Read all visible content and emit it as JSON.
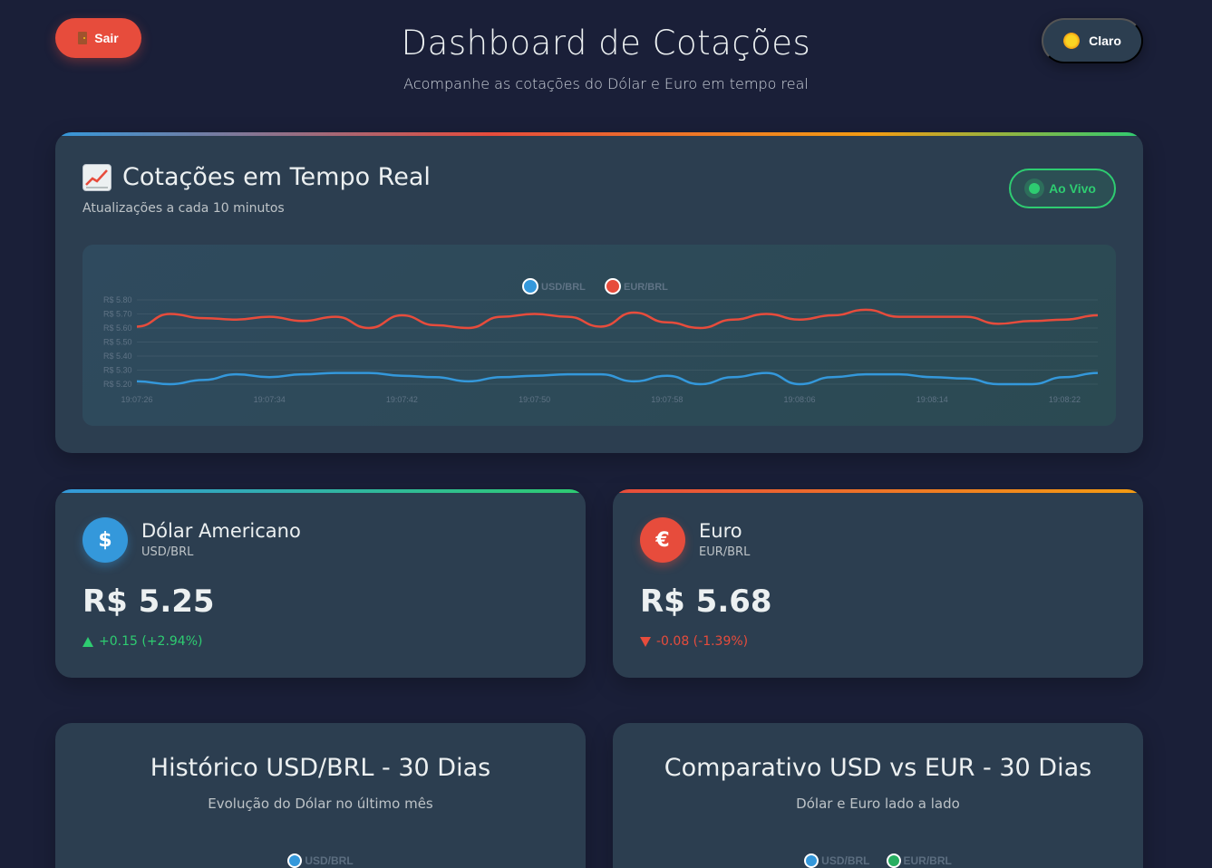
{
  "topbar": {
    "logout_label": "Sair",
    "theme_label": "Claro"
  },
  "header": {
    "title": "Dashboard de Cotações",
    "subtitle": "Acompanhe as cotações do Dólar e Euro em tempo real"
  },
  "realtime": {
    "title": "Cotações em Tempo Real",
    "subtitle": "Atualizações a cada 10 minutos",
    "live_label": "Ao Vivo"
  },
  "chart_data": {
    "type": "line",
    "x": [
      "19:07:26",
      "19:07:28",
      "19:07:30",
      "19:07:32",
      "19:07:34",
      "19:07:36",
      "19:07:38",
      "19:07:40",
      "19:07:42",
      "19:07:44",
      "19:07:46",
      "19:07:48",
      "19:07:50",
      "19:07:52",
      "19:07:54",
      "19:07:56",
      "19:07:58",
      "19:08:00",
      "19:08:02",
      "19:08:04",
      "19:08:06",
      "19:08:08",
      "19:08:10",
      "19:08:12",
      "19:08:14",
      "19:08:16",
      "19:08:18",
      "19:08:20",
      "19:08:22",
      "19:08:24"
    ],
    "x_ticks": [
      "19:07:26",
      "19:07:34",
      "19:07:42",
      "19:07:50",
      "19:07:58",
      "19:08:06",
      "19:08:14",
      "19:08:22"
    ],
    "y_ticks": [
      "R$ 5.80",
      "R$ 5.70",
      "R$ 5.60",
      "R$ 5.50",
      "R$ 5.40",
      "R$ 5.30",
      "R$ 5.20"
    ],
    "ylim": [
      5.2,
      5.8
    ],
    "series": [
      {
        "name": "USD/BRL",
        "color": "#3498db",
        "values": [
          5.22,
          5.2,
          5.23,
          5.27,
          5.25,
          5.27,
          5.28,
          5.28,
          5.26,
          5.25,
          5.22,
          5.25,
          5.26,
          5.27,
          5.27,
          5.22,
          5.26,
          5.2,
          5.25,
          5.28,
          5.2,
          5.25,
          5.27,
          5.27,
          5.25,
          5.24,
          5.2,
          5.2,
          5.25,
          5.28
        ]
      },
      {
        "name": "EUR/BRL",
        "color": "#e74c3c",
        "values": [
          5.61,
          5.7,
          5.67,
          5.66,
          5.68,
          5.65,
          5.68,
          5.6,
          5.69,
          5.62,
          5.6,
          5.68,
          5.7,
          5.68,
          5.61,
          5.71,
          5.64,
          5.6,
          5.66,
          5.7,
          5.66,
          5.69,
          5.73,
          5.68,
          5.68,
          5.68,
          5.63,
          5.65,
          5.66,
          5.69
        ]
      }
    ]
  },
  "currencies": {
    "usd": {
      "symbol": "$",
      "name": "Dólar Americano",
      "pair": "USD/BRL",
      "value": "R$ 5.25",
      "change": "+0.15 (+2.94%)"
    },
    "eur": {
      "symbol": "€",
      "name": "Euro",
      "pair": "EUR/BRL",
      "value": "R$ 5.68",
      "change": "-0.08 (-1.39%)"
    }
  },
  "history": {
    "usd": {
      "title": "Histórico USD/BRL - 30 Dias",
      "subtitle": "Evolução do Dólar no último mês",
      "legend": [
        "USD/BRL"
      ],
      "legend_colors": [
        "#3498db"
      ]
    },
    "compare": {
      "title": "Comparativo USD vs EUR - 30 Dias",
      "subtitle": "Dólar e Euro lado a lado",
      "legend": [
        "USD/BRL",
        "EUR/BRL"
      ],
      "legend_colors": [
        "#3498db",
        "#27ae60"
      ]
    }
  }
}
